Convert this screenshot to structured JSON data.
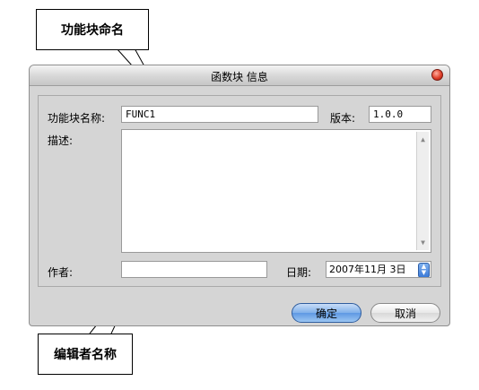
{
  "annotations": {
    "top_callout": "功能块命名",
    "bottom_callout": "编辑者名称"
  },
  "dialog": {
    "title": "函数块 信息",
    "name_label": "功能块名称:",
    "name_value": "FUNC1",
    "version_label": "版本:",
    "version_value": "1.0.0",
    "description_label": "描述:",
    "description_value": "",
    "author_label": "作者:",
    "author_value": "",
    "date_label": "日期:",
    "date_value": "2007年11月 3日",
    "ok_label": "确定",
    "cancel_label": "取消"
  },
  "colors": {
    "ok_button": "#7fb0ea",
    "close_button": "#e0402a",
    "dialog_bg": "#d5d5d5"
  },
  "icons": {
    "close": "close-icon",
    "scroll_up": "scroll-up-icon",
    "scroll_down": "scroll-down-icon",
    "date_stepper": "stepper-icon"
  }
}
